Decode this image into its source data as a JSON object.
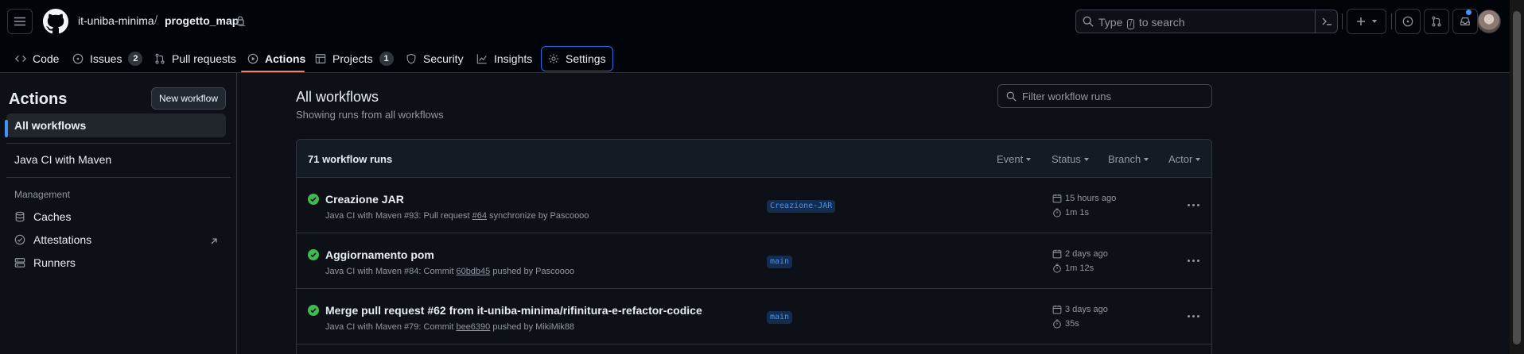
{
  "header": {
    "owner": "it-uniba-minima",
    "separator": "/",
    "repo": "progetto_map_",
    "search_placeholder_before": "Type",
    "search_key": "/",
    "search_placeholder_after": "to search"
  },
  "tabs": [
    {
      "label": "Code",
      "icon": "code-icon"
    },
    {
      "label": "Issues",
      "count": "2",
      "icon": "issue-opened-icon"
    },
    {
      "label": "Pull requests",
      "icon": "git-pull-request-icon"
    },
    {
      "label": "Actions",
      "icon": "play-icon",
      "active": true
    },
    {
      "label": "Projects",
      "count": "1",
      "icon": "table-icon"
    },
    {
      "label": "Security",
      "icon": "shield-icon"
    },
    {
      "label": "Insights",
      "icon": "graph-icon"
    },
    {
      "label": "Settings",
      "icon": "gear-icon"
    }
  ],
  "sidebar": {
    "title": "Actions",
    "new_workflow": "New workflow",
    "all_workflows": "All workflows",
    "workflow": "Java CI with Maven",
    "management_heading": "Management",
    "management_items": [
      {
        "label": "Caches",
        "icon": "database-icon"
      },
      {
        "label": "Attestations",
        "icon": "verified-icon"
      },
      {
        "label": "Runners",
        "icon": "server-icon"
      }
    ]
  },
  "main": {
    "title": "All workflows",
    "subtitle": "Showing runs from all workflows",
    "filter_placeholder": "Filter workflow runs",
    "runs_count": "71 workflow runs",
    "filters": [
      "Event",
      "Status",
      "Branch",
      "Actor"
    ],
    "runs": [
      {
        "name": "Creazione JAR",
        "meta_prefix": "Java CI with Maven #93: Pull request ",
        "meta_link": "#64",
        "meta_suffix": " synchronize by Pascoooo",
        "branch": "Creazione-JAR",
        "when": "15 hours ago",
        "duration": "1m 1s",
        "status": "success"
      },
      {
        "name": "Aggiornamento pom",
        "meta_prefix": "Java CI with Maven #84: Commit ",
        "meta_link": "60bdb45",
        "meta_suffix": " pushed by Pascoooo",
        "branch": "main",
        "when": "2 days ago",
        "duration": "1m 12s",
        "status": "success"
      },
      {
        "name": "Merge pull request #62 from it-uniba-minima/rifinitura-e-refactor-codice",
        "meta_prefix": "Java CI with Maven #79: Commit ",
        "meta_link": "bee6390",
        "meta_suffix": " pushed by MikiMik88",
        "branch": "main",
        "when": "3 days ago",
        "duration": "35s",
        "status": "success"
      }
    ]
  },
  "colors": {
    "background": "#0d1117",
    "header": "#010409",
    "accent": "#4493f8",
    "success": "#3fb950",
    "active_tab_underline": "#f78166"
  }
}
